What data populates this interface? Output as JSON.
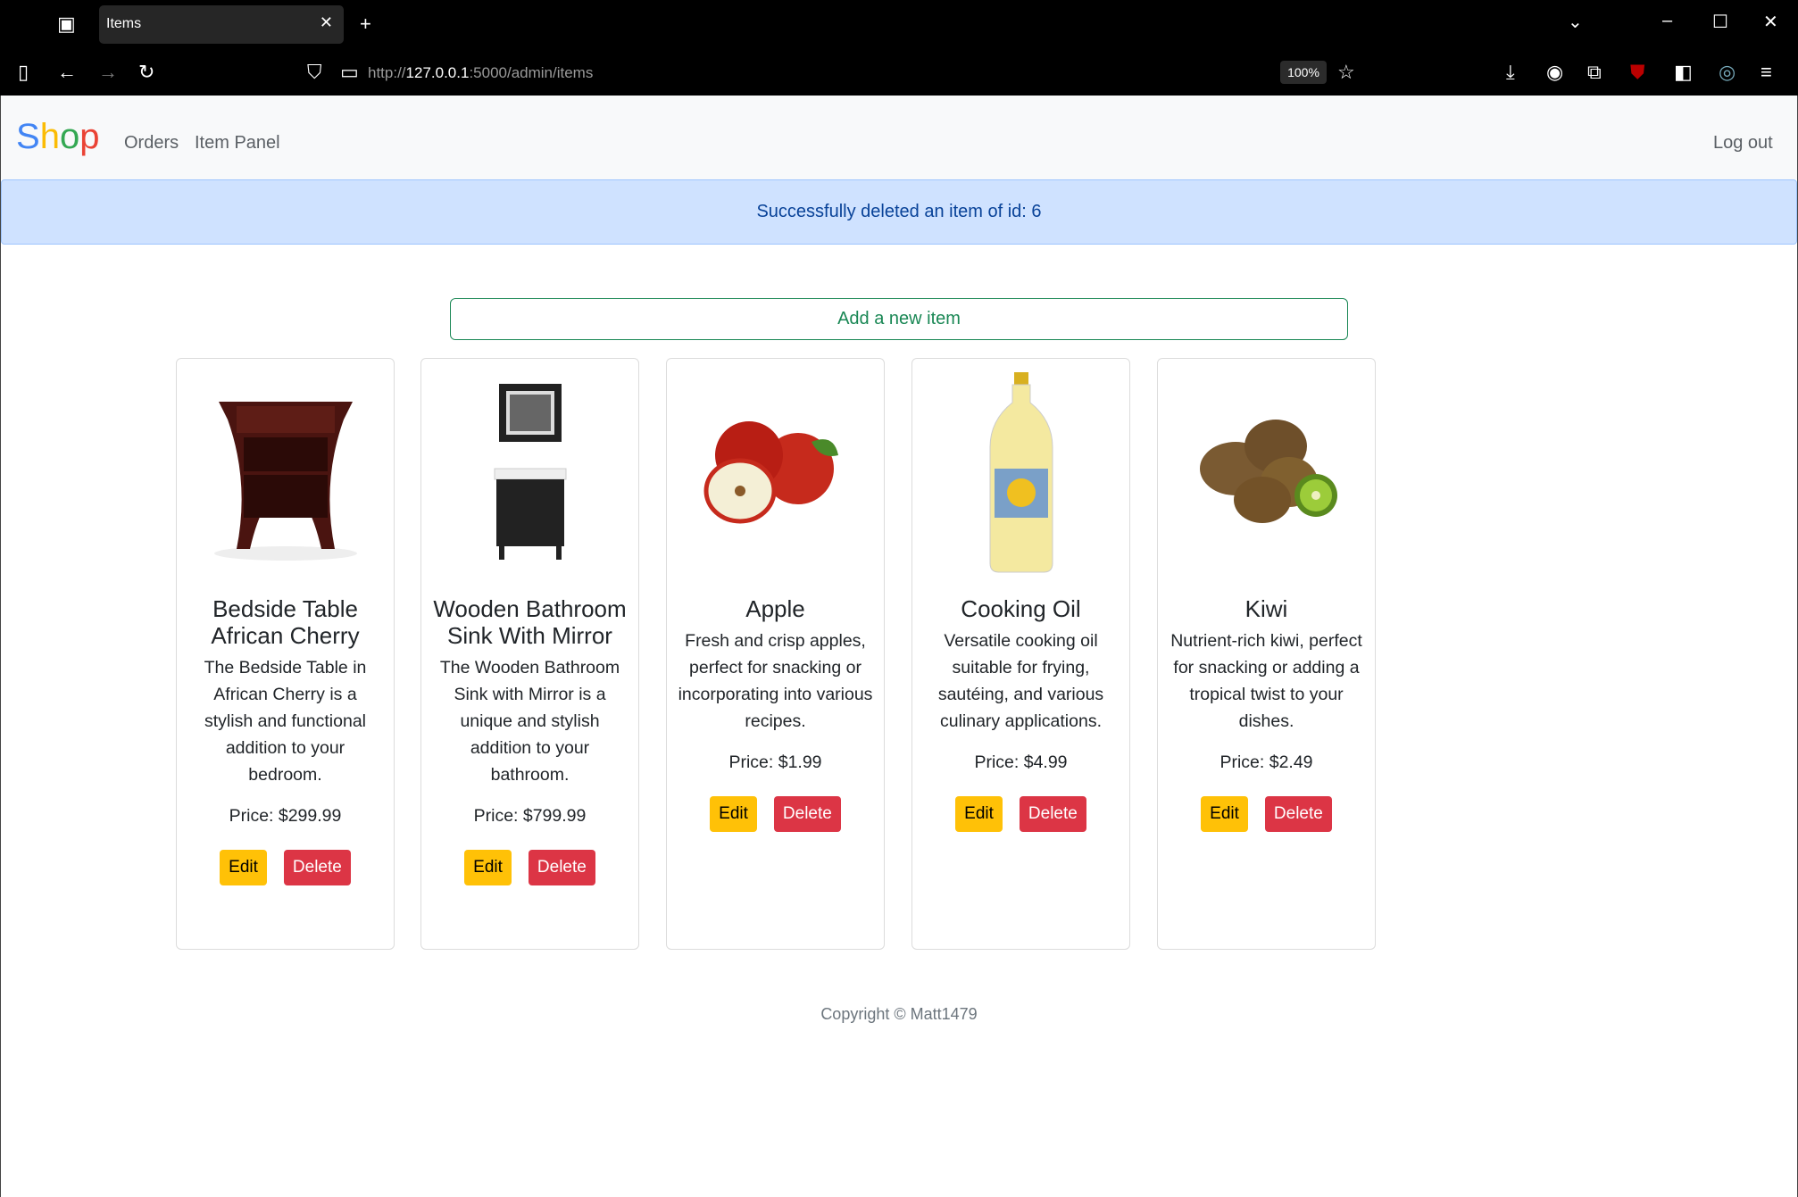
{
  "browser": {
    "tab_title": "Items",
    "url_prefix": "http://",
    "url_host": "127.0.0.1",
    "url_rest": ":5000/admin/items",
    "zoom": "100%"
  },
  "navbar": {
    "brand": [
      "S",
      "h",
      "o",
      "p"
    ],
    "brand_colors": [
      "#4285f4",
      "#fbbc05",
      "#34a853",
      "#ea4335"
    ],
    "links": [
      "Orders",
      "Item Panel"
    ],
    "logout": "Log out"
  },
  "alert": {
    "message": "Successfully deleted an item of id: 6"
  },
  "add_button": "Add a new item",
  "items": [
    {
      "title": "Bedside Table African Cherry",
      "description": "The Bedside Table in African Cherry is a stylish and functional addition to your bedroom.",
      "price": "Price: $299.99",
      "edit": "Edit",
      "delete": "Delete"
    },
    {
      "title": "Wooden Bathroom Sink With Mirror",
      "description": "The Wooden Bathroom Sink with Mirror is a unique and stylish addition to your bathroom.",
      "price": "Price: $799.99",
      "edit": "Edit",
      "delete": "Delete"
    },
    {
      "title": "Apple",
      "description": "Fresh and crisp apples, perfect for snacking or incorporating into various recipes.",
      "price": "Price: $1.99",
      "edit": "Edit",
      "delete": "Delete"
    },
    {
      "title": "Cooking Oil",
      "description": "Versatile cooking oil suitable for frying, sautéing, and various culinary applications.",
      "price": "Price: $4.99",
      "edit": "Edit",
      "delete": "Delete"
    },
    {
      "title": "Kiwi",
      "description": "Nutrient-rich kiwi, perfect for snacking or adding a tropical twist to your dishes.",
      "price": "Price: $2.49",
      "edit": "Edit",
      "delete": "Delete"
    }
  ],
  "footer": "Copyright © Matt1479"
}
